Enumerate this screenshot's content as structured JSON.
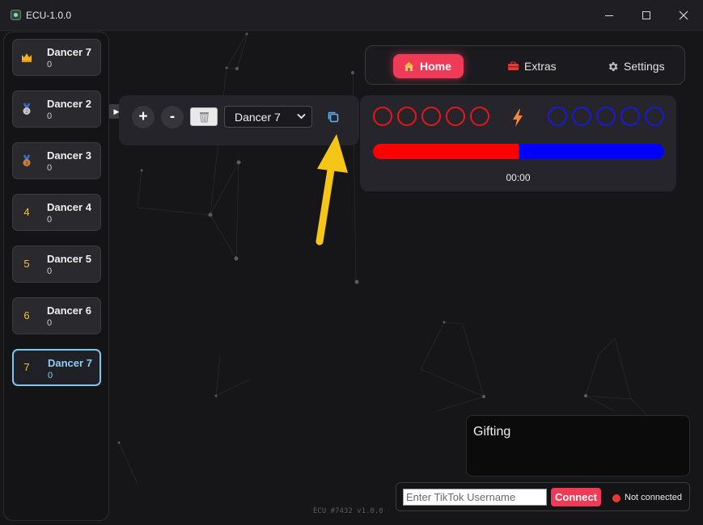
{
  "window": {
    "title": "ECU-1.0.0"
  },
  "sidebar": {
    "dancers": [
      {
        "rank_icon": "crown-icon",
        "rank": "",
        "name": "Dancer 7",
        "score": "0"
      },
      {
        "rank_icon": "silver-medal-icon",
        "rank": "",
        "name": "Dancer 2",
        "score": "0"
      },
      {
        "rank_icon": "bronze-medal-icon",
        "rank": "",
        "name": "Dancer 3",
        "score": "0"
      },
      {
        "rank_icon": "",
        "rank": "4",
        "name": "Dancer 4",
        "score": "0"
      },
      {
        "rank_icon": "",
        "rank": "5",
        "name": "Dancer 5",
        "score": "0"
      },
      {
        "rank_icon": "",
        "rank": "6",
        "name": "Dancer 6",
        "score": "0"
      },
      {
        "rank_icon": "",
        "rank": "7",
        "name": "Dancer 7",
        "score": "0",
        "active": true
      }
    ]
  },
  "controls": {
    "plus_label": "+",
    "minus_label": "-",
    "selected_dancer": "Dancer 7"
  },
  "nav": {
    "tabs": [
      {
        "label": "Home",
        "icon": "house-icon",
        "active": true
      },
      {
        "label": "Extras",
        "icon": "toolbox-icon",
        "active": false
      },
      {
        "label": "Settings",
        "icon": "gear-icon",
        "active": false
      }
    ]
  },
  "battle": {
    "red_points": 5,
    "blue_points": 5,
    "red_share": 0.5,
    "timer": "00:00",
    "colors": {
      "red": "#ff0000",
      "blue": "#0000ff",
      "accent": "#ef3b57",
      "bolt": "#f5883a"
    }
  },
  "gifting": {
    "title": "Gifting"
  },
  "connect": {
    "username_placeholder": "Enter TikTok Username",
    "button_label": "Connect",
    "status": "Not connected"
  },
  "footer": {
    "version": "ECU #7432 v1.0.0"
  }
}
